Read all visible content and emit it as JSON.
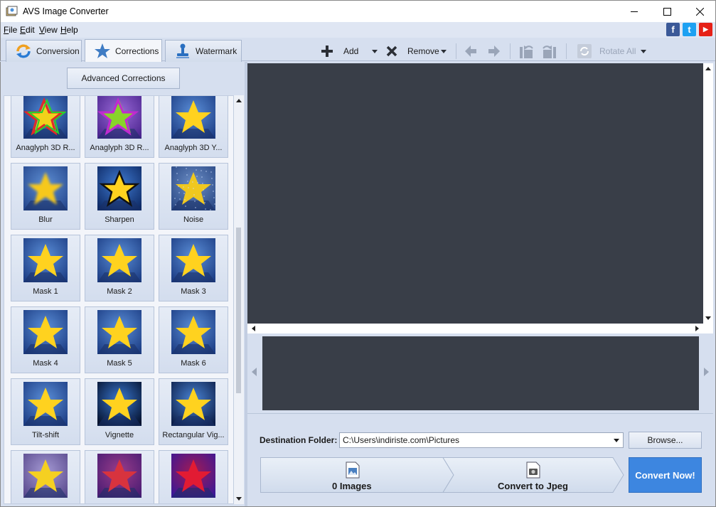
{
  "window": {
    "title": "AVS Image Converter"
  },
  "menu": [
    "File",
    "Edit",
    "View",
    "Help"
  ],
  "social": [
    {
      "name": "facebook-icon",
      "glyph": "f",
      "color": "#3b5998"
    },
    {
      "name": "twitter-icon",
      "glyph": "t",
      "color": "#1da1f2"
    },
    {
      "name": "youtube-icon",
      "glyph": "▶",
      "color": "#e62117"
    }
  ],
  "tabs": [
    {
      "label": "Conversion",
      "active": false
    },
    {
      "label": "Corrections",
      "active": true
    },
    {
      "label": "Watermark",
      "active": false
    }
  ],
  "toolbar": {
    "add_label": "Add",
    "remove_label": "Remove",
    "rotate_all_label": "Rotate All"
  },
  "left": {
    "advanced_label": "Advanced Corrections",
    "effects": [
      {
        "label": "Anaglyph 3D R...",
        "style": "rgb"
      },
      {
        "label": "Anaglyph 3D R...",
        "style": "purple"
      },
      {
        "label": "Anaglyph 3D Y...",
        "style": "normal"
      },
      {
        "label": "Blur",
        "style": "blur"
      },
      {
        "label": "Sharpen",
        "style": "sharpen"
      },
      {
        "label": "Noise",
        "style": "noise"
      },
      {
        "label": "Mask 1",
        "style": "normal"
      },
      {
        "label": "Mask 2",
        "style": "normal"
      },
      {
        "label": "Mask 3",
        "style": "normal"
      },
      {
        "label": "Mask 4",
        "style": "normal"
      },
      {
        "label": "Mask 5",
        "style": "normal"
      },
      {
        "label": "Mask 6",
        "style": "normal"
      },
      {
        "label": "Tilt-shift",
        "style": "normal"
      },
      {
        "label": "Vignette",
        "style": "vignette"
      },
      {
        "label": "Rectangular Vig...",
        "style": "rectvig"
      },
      {
        "label": "",
        "style": "lavender"
      },
      {
        "label": "",
        "style": "redpurple"
      },
      {
        "label": "",
        "style": "red"
      }
    ]
  },
  "destination": {
    "label": "Destination Folder:",
    "value": "C:\\Users\\indiriste.com\\Pictures",
    "browse_label": "Browse..."
  },
  "flow": {
    "images_label": "0 Images",
    "convert_to_label": "Convert to Jpeg"
  },
  "convert_button": "Convert Now!"
}
